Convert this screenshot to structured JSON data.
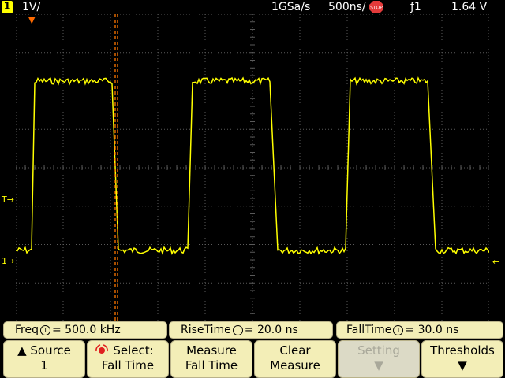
{
  "status": {
    "channel": "1",
    "vdiv": "1V/",
    "sample_rate": "1GSa/s",
    "timebase": "500ns/",
    "run_state": "STOP",
    "trigger": "ƒ1",
    "trigger_level": "1.64 V"
  },
  "markers": {
    "trigger_pos": "▼",
    "trigger_level": "T→",
    "ground": "1→",
    "right": "←"
  },
  "measurements": {
    "freq": {
      "label": "Freq",
      "source": "1",
      "value": "= 500.0 kHz"
    },
    "rise": {
      "label": "RiseTime",
      "source": "1",
      "value": "=  20.0 ns"
    },
    "fall": {
      "label": "FallTime",
      "source": "1",
      "value": "=  30.0 ns"
    }
  },
  "softkeys": [
    {
      "line1": "▲ Source",
      "line2": "1"
    },
    {
      "line1": "Select:",
      "line2": "Fall Time"
    },
    {
      "line1": "Measure",
      "line2": "Fall Time"
    },
    {
      "line1": "Clear",
      "line2": "Measure"
    },
    {
      "line1": "Setting",
      "line2": "▼",
      "disabled": true
    },
    {
      "line1": "Thresholds",
      "line2": "▼"
    }
  ],
  "colors": {
    "trace": "#ffff00",
    "cursor": "#ff7700",
    "grid": "#5a5a5a",
    "softkey_bg": "#f3eeb7",
    "ground_marker": "#ffff00",
    "trigger_marker": "#ff6a00"
  },
  "waveform": {
    "frequency_khz": 500.0,
    "rise_time_ns": 20.0,
    "fall_time_ns": 30.0
  }
}
